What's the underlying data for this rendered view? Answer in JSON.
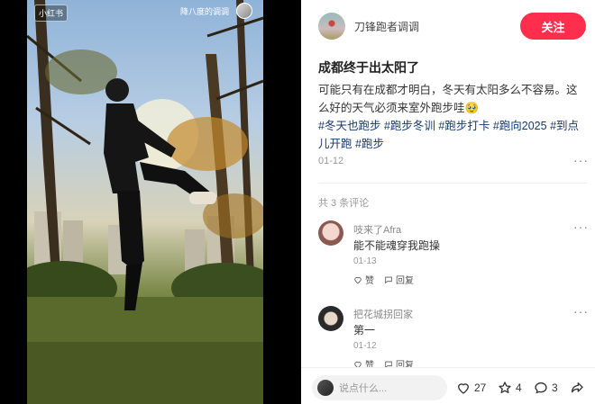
{
  "media": {
    "logo_text": "小红书",
    "video_title": "降八度的调调"
  },
  "author": {
    "name": "刀锋跑者调调",
    "follow_label": "关注"
  },
  "note": {
    "title": "成都终于出太阳了",
    "body": "可能只有在成都才明白，冬天有太阳多么不容易。这么好的天气必须来室外跑步哇🥹",
    "tags": [
      "#冬天也跑步",
      "#跑步冬训",
      "#跑步打卡",
      "#跑向2025",
      "#到点儿开跑",
      "#跑步"
    ],
    "date": "01-12"
  },
  "comments_header": "共 3 条评论",
  "comments": [
    {
      "name": "吱来了Afra",
      "text": "能不能魂穿我跑操",
      "date": "01-13",
      "like_label": "赞",
      "reply_label": "回复"
    },
    {
      "name": "把花城拐回家",
      "text": "第一",
      "date": "01-12",
      "like_label": "赞",
      "reply_label": "回复"
    }
  ],
  "bottom": {
    "input_placeholder": "说点什么...",
    "likes": "27",
    "collects": "4",
    "comments": "3"
  },
  "colors": {
    "accent": "#ff2e4d",
    "tag": "#13386c"
  }
}
